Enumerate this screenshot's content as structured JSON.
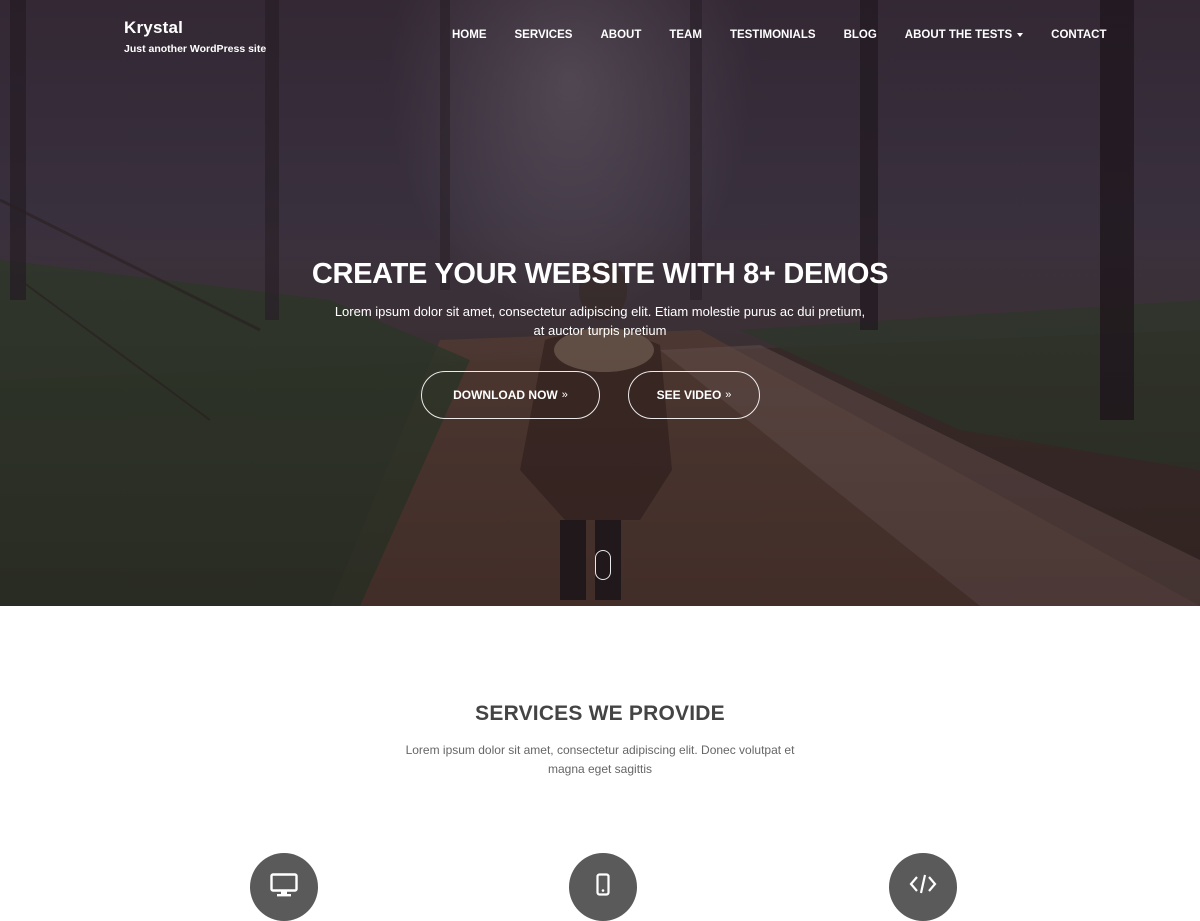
{
  "site": {
    "title": "Krystal",
    "tagline": "Just another WordPress site"
  },
  "nav": {
    "items": [
      {
        "label": "Home"
      },
      {
        "label": "Services"
      },
      {
        "label": "About"
      },
      {
        "label": "Team"
      },
      {
        "label": "Testimonials"
      },
      {
        "label": "Blog"
      },
      {
        "label": "About The Tests",
        "has_dropdown": true
      },
      {
        "label": "Contact"
      }
    ]
  },
  "hero": {
    "title": "Create your website with 8+ demos",
    "text": "Lorem ipsum dolor sit amet, consectetur adipiscing elit. Etiam molestie purus ac dui pretium, at auctor turpis pretium",
    "buttons": {
      "download": "Download now",
      "video": "See video",
      "chevron": "»"
    }
  },
  "services": {
    "title": "Services we provide",
    "description": "Lorem ipsum dolor sit amet, consectetur adipiscing elit. Donec volutpat et magna eget sagittis",
    "icons": [
      "desktop-icon",
      "mobile-icon",
      "code-icon"
    ]
  },
  "colors": {
    "icon_circle": "#5a5a5a",
    "heading": "#444444",
    "text_light": "#ffffff"
  }
}
